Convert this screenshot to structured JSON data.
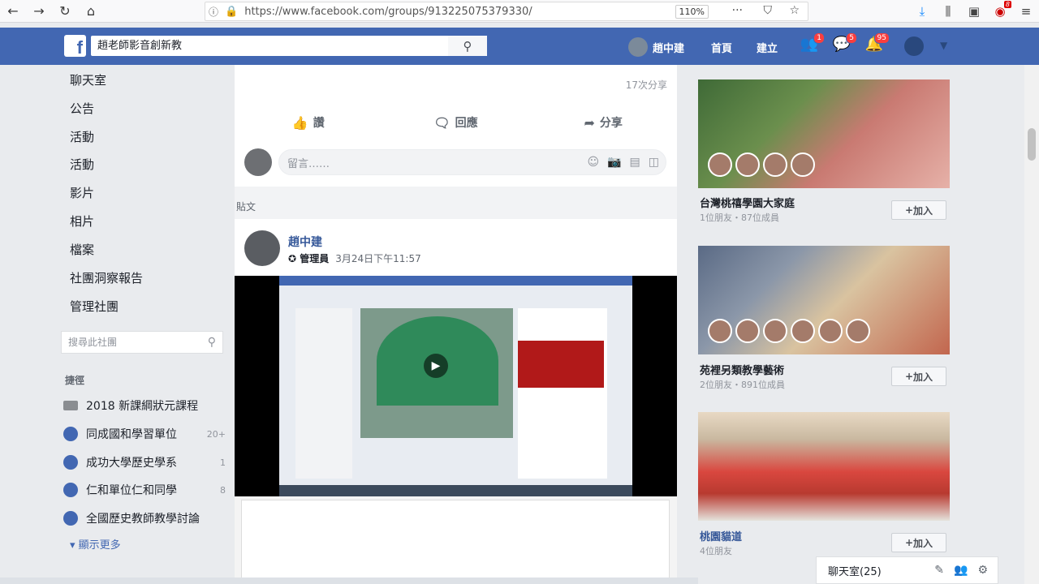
{
  "browser": {
    "url": "https://www.facebook.com/groups/913225075379330/",
    "zoom": "110%",
    "ext_badge": "8"
  },
  "fb": {
    "logo": "f",
    "search_value": "趙老師影音創新教",
    "user_name": "趙中建",
    "nav_home": "首頁",
    "nav_create": "建立",
    "badges": {
      "friends": "1",
      "messages": "5",
      "notifications": "95"
    }
  },
  "left_nav": {
    "items": [
      "聊天室",
      "公告",
      "活動",
      "活動",
      "影片",
      "相片",
      "檔案",
      "社團洞察報告",
      "管理社團"
    ],
    "group_search_placeholder": "搜尋此社團",
    "section_title": "捷徑",
    "groups": [
      {
        "name": "2018 新課綱狀元課程",
        "count": ""
      },
      {
        "name": "同成國和學習單位",
        "count": "20+"
      },
      {
        "name": "成功大學歷史學系",
        "count": "1"
      },
      {
        "name": "仁和單位仁和同學",
        "count": "8"
      },
      {
        "name": "全國歷史教師教學討論",
        "count": ""
      }
    ],
    "more": "顯示更多"
  },
  "feed": {
    "shares": "17次分享",
    "like": "讚",
    "comment": "回應",
    "share": "分享",
    "comment_placeholder": "留言……",
    "section_label": "貼文",
    "post_author": "趙中建",
    "post_role": "管理員",
    "post_time": "3月24日下午11:57"
  },
  "right": {
    "cards": [
      {
        "title": "台灣桃禧學園大家庭",
        "sub": "1位朋友・87位成員",
        "join": "加入"
      },
      {
        "title": "苑裡另類教學藝術",
        "sub": "2位朋友・891位成員",
        "join": "加入"
      },
      {
        "title": "桃園貓道",
        "sub": "4位朋友",
        "join": "加入"
      }
    ]
  },
  "chat": {
    "label": "聊天室(25)"
  },
  "colors": {
    "fb_blue": "#4267b2",
    "link": "#365899"
  },
  "icons": {
    "back": "back-icon",
    "forward": "forward-icon",
    "reload": "reload-icon",
    "home": "home-icon",
    "search": "search-icon",
    "like": "thumbs-up-icon",
    "comment": "comment-icon",
    "share": "share-icon"
  }
}
